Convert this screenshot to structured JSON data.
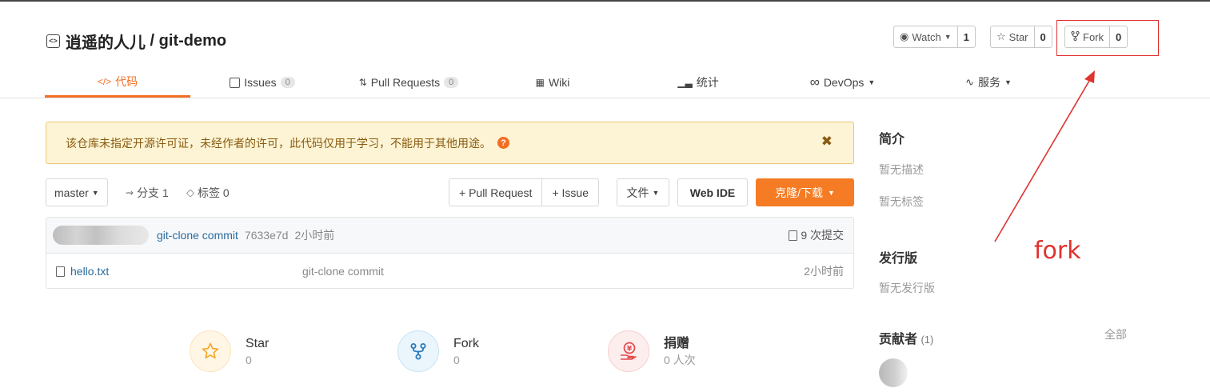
{
  "repo": {
    "owner": "逍遥的人儿",
    "separator": " / ",
    "name": "git-demo"
  },
  "social": {
    "watch_label": "Watch",
    "watch_count": "1",
    "star_label": "Star",
    "star_count": "0",
    "fork_label": "Fork",
    "fork_count": "0"
  },
  "tabs": [
    {
      "label": "代码",
      "icon": "code-icon"
    },
    {
      "label": "Issues",
      "badge": "0",
      "icon": "issues-icon"
    },
    {
      "label": "Pull Requests",
      "badge": "0",
      "icon": "pull-request-icon"
    },
    {
      "label": "Wiki",
      "icon": "wiki-icon"
    },
    {
      "label": "统计",
      "icon": "chart-icon"
    },
    {
      "label": "DevOps",
      "icon": "infinity-icon"
    },
    {
      "label": "服务",
      "icon": "pulse-icon"
    }
  ],
  "notice": {
    "text": "该仓库未指定开源许可证，未经作者的许可，此代码仅用于学习，不能用于其他用途。"
  },
  "toolbar": {
    "branch": "master",
    "branches": "分支 1",
    "tags": "标签 0",
    "pull_request": "+ Pull Request",
    "issue": "+ Issue",
    "files": "文件",
    "web_ide": "Web IDE",
    "clone": "克隆/下载"
  },
  "commit": {
    "message": "git-clone commit",
    "hash": "7633e7d",
    "time": "2小时前",
    "count": "9 次提交"
  },
  "files": [
    {
      "name": "hello.txt",
      "message": "git-clone commit",
      "time": "2小时前"
    }
  ],
  "stats": [
    {
      "title": "Star",
      "value": "0",
      "icon": "star-icon"
    },
    {
      "title": "Fork",
      "value": "0",
      "icon": "fork-icon"
    },
    {
      "title": "捐赠",
      "value": "0 人次",
      "icon": "donate-icon"
    }
  ],
  "sidebar": {
    "intro_title": "简介",
    "intro_text": "暂无描述",
    "tags_text": "暂无标签",
    "release_title": "发行版",
    "release_text": "暂无发行版",
    "contrib_title": "贡献者",
    "contrib_count": "(1)",
    "contrib_all": "全部"
  },
  "annotation": {
    "label": "fork",
    "color": "#e0322f"
  },
  "colors": {
    "accent": "#f36e24",
    "link": "#2a6b9e",
    "notice_bg": "#fcf4d4"
  }
}
